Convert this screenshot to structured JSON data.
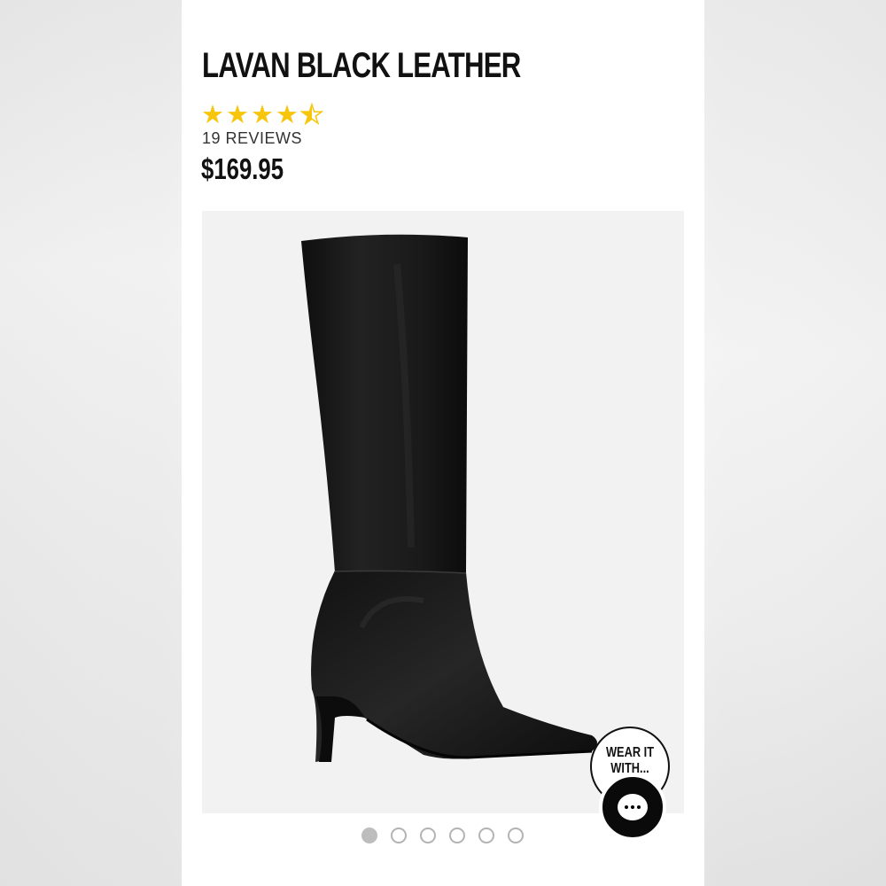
{
  "product": {
    "title": "LAVAN BLACK LEATHER",
    "rating": 4.5,
    "rating_max": 5,
    "reviews_label": "19 REVIEWS",
    "price": "$169.95"
  },
  "gallery": {
    "image_subject": "black leather knee-high boot",
    "total_images": 6,
    "active_index": 0
  },
  "wear_it_with": {
    "line1": "WEAR IT",
    "line2": "WITH..."
  },
  "chat": {
    "icon": "chat-bubble-icon"
  },
  "colors": {
    "star": "#f7c60c",
    "text": "#111111",
    "image_bg": "#f2f2f2",
    "boot": "#1a1a1a"
  }
}
